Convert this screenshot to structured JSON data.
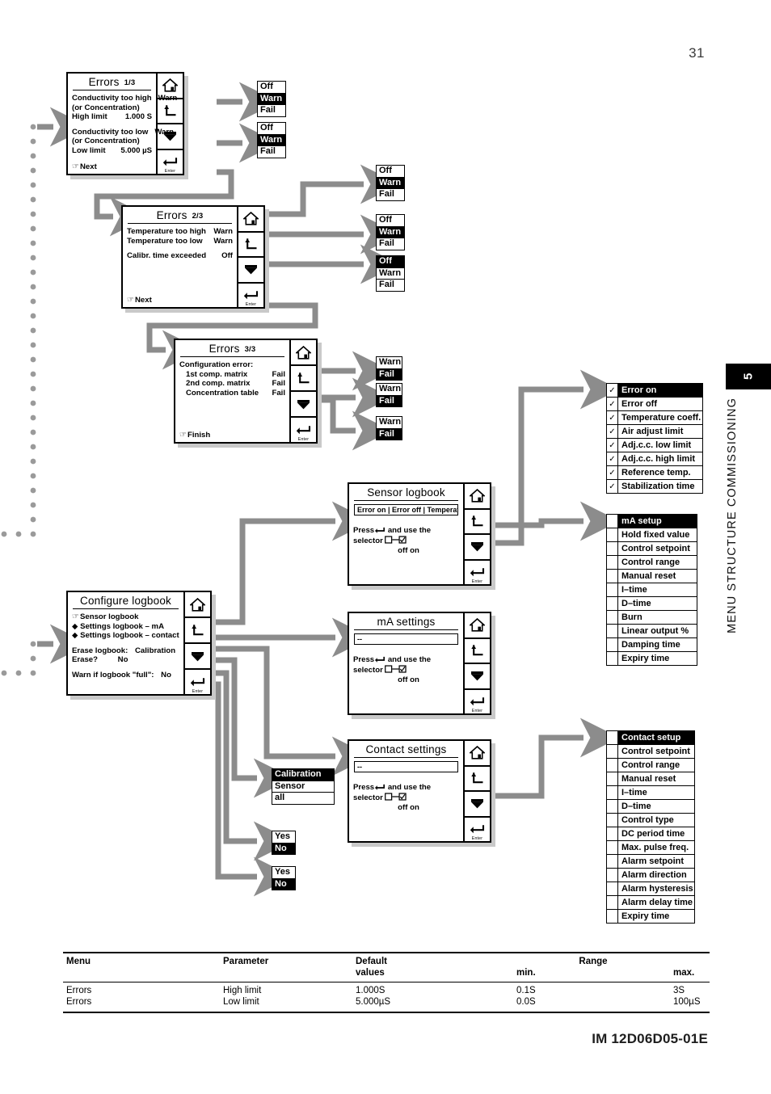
{
  "page": {
    "number": "31",
    "footer_code": "IM 12D06D05-01E",
    "side_tab_number": "5",
    "side_tab_title": "MENU STRUCTURE COMMISSIONING"
  },
  "panels": {
    "errors1": {
      "title": "Errors",
      "page_indicator": "1/3",
      "rows": [
        {
          "label": "Conductivity too high",
          "value": "Warn"
        },
        {
          "label": "(or Concentration)",
          "value": ""
        },
        {
          "label": "High limit",
          "value": "1.000 S"
        },
        {
          "label": "Conductivity too low",
          "value": "Warn"
        },
        {
          "label": "(or Concentration)",
          "value": ""
        },
        {
          "label": "Low limit",
          "value": "5.000  µS"
        }
      ],
      "footer": "Next"
    },
    "errors2": {
      "title": "Errors",
      "page_indicator": "2/3",
      "rows": [
        {
          "label": "Temperature too high",
          "value": "Warn"
        },
        {
          "label": "Temperature too low",
          "value": "Warn"
        },
        {
          "label": "Calibr. time exceeded",
          "value": "Off"
        }
      ],
      "footer": "Next"
    },
    "errors3": {
      "title": "Errors",
      "page_indicator": "3/3",
      "heading": "Configuration error:",
      "rows": [
        {
          "label": "1st comp. matrix",
          "value": "Fail"
        },
        {
          "label": "2nd comp. matrix",
          "value": "Fail"
        },
        {
          "label": "Concentration table",
          "value": "Fail"
        }
      ],
      "footer": "Finish"
    },
    "configure_logbook": {
      "title": "Configure logbook",
      "items": [
        "Sensor logbook",
        "Settings logbook – mA",
        "Settings logbook – contact"
      ],
      "rows": [
        {
          "label": "Erase logbook:",
          "value": "Calibration"
        },
        {
          "label": "Erase?",
          "value": "No"
        },
        {
          "label": "Warn if logbook \"full\":",
          "value": "No"
        }
      ]
    },
    "sensor_logbook": {
      "title": "Sensor logbook",
      "field_value": "Error on | Error off | Temperat",
      "press_line1": "Press",
      "press_enter_label": "Enter",
      "press_line1b": "and use the",
      "press_line2": "selector",
      "off_on": "off  on"
    },
    "ma_settings": {
      "title": "mA settings",
      "field_value": "--",
      "press_line1": "Press",
      "press_enter_label": "Enter",
      "press_line1b": "and use the",
      "press_line2": "selector",
      "off_on": "off  on"
    },
    "contact_settings": {
      "title": "Contact settings",
      "field_value": "--",
      "press_line1": "Press",
      "press_enter_label": "Enter",
      "press_line1b": "and use the",
      "press_line2": "selector",
      "off_on": "off  on"
    }
  },
  "nav_keys": [
    "home-icon",
    "back-icon",
    "down-icon",
    "enter-icon"
  ],
  "nav_enter_label": "Enter",
  "option_boxes": {
    "owf_a": {
      "options": [
        "Off",
        "Warn",
        "Fail"
      ],
      "selected": "Warn"
    },
    "owf_b": {
      "options": [
        "Off",
        "Warn",
        "Fail"
      ],
      "selected": "Warn"
    },
    "owf_c": {
      "options": [
        "Off",
        "Warn",
        "Fail"
      ],
      "selected": "Warn"
    },
    "owf_d": {
      "options": [
        "Off",
        "Warn",
        "Fail"
      ],
      "selected": "Warn"
    },
    "owf_e": {
      "options": [
        "Off",
        "Warn",
        "Fail"
      ],
      "selected": "Off"
    },
    "wf_a": {
      "options": [
        "Warn",
        "Fail"
      ],
      "selected": "Fail"
    },
    "wf_b": {
      "options": [
        "Warn",
        "Fail"
      ],
      "selected": "Fail"
    },
    "wf_c": {
      "options": [
        "Warn",
        "Fail"
      ],
      "selected": "Fail"
    },
    "erase_target": {
      "options": [
        "Calibration",
        "Sensor",
        "all"
      ],
      "selected": "Calibration"
    },
    "yesno_a": {
      "options": [
        "Yes",
        "No"
      ],
      "selected": "No"
    },
    "yesno_b": {
      "options": [
        "Yes",
        "No"
      ],
      "selected": "No"
    }
  },
  "checkbox_lists": {
    "sensor_logbook_items": {
      "header": "Error on",
      "header_checked": true,
      "items": [
        {
          "label": "Error off",
          "checked": true
        },
        {
          "label": "Temperature coeff.",
          "checked": true
        },
        {
          "label": "Air adjust limit",
          "checked": true
        },
        {
          "label": "Adj.c.c. low limit",
          "checked": true
        },
        {
          "label": "Adj.c.c. high limit",
          "checked": true
        },
        {
          "label": "Reference temp.",
          "checked": true
        },
        {
          "label": "Stabilization time",
          "checked": true
        }
      ]
    },
    "ma_setup_items": {
      "header": "mA setup",
      "header_checked": false,
      "items": [
        {
          "label": "Hold fixed value",
          "checked": false
        },
        {
          "label": "Control setpoint",
          "checked": false
        },
        {
          "label": "Control range",
          "checked": false
        },
        {
          "label": "Manual reset",
          "checked": false
        },
        {
          "label": "I–time",
          "checked": false
        },
        {
          "label": "D–time",
          "checked": false
        },
        {
          "label": "Burn",
          "checked": false
        },
        {
          "label": "Linear output %",
          "checked": false
        },
        {
          "label": "Damping time",
          "checked": false
        },
        {
          "label": "Expiry time",
          "checked": false
        }
      ]
    },
    "contact_setup_items": {
      "header": "Contact setup",
      "header_checked": false,
      "items": [
        {
          "label": "Control setpoint",
          "checked": false
        },
        {
          "label": "Control range",
          "checked": false
        },
        {
          "label": "Manual reset",
          "checked": false
        },
        {
          "label": "I–time",
          "checked": false
        },
        {
          "label": "D–time",
          "checked": false
        },
        {
          "label": "Control type",
          "checked": false
        },
        {
          "label": "DC period time",
          "checked": false
        },
        {
          "label": "Max. pulse freq.",
          "checked": false
        },
        {
          "label": "Alarm setpoint",
          "checked": false
        },
        {
          "label": "Alarm direction",
          "checked": false
        },
        {
          "label": "Alarm hysteresis",
          "checked": false
        },
        {
          "label": "Alarm delay time",
          "checked": false
        },
        {
          "label": "Expiry time",
          "checked": false
        }
      ]
    }
  },
  "spec_table": {
    "headers_row1": [
      "Menu",
      "Parameter",
      "Default",
      "Range",
      ""
    ],
    "headers_row2": [
      "",
      "",
      "values",
      "min.",
      "max."
    ],
    "rows": [
      {
        "menu": "Errors",
        "parameter": "High limit",
        "default": "1.000S",
        "min": "0.1S",
        "max": "3S"
      },
      {
        "menu": "Errors",
        "parameter": "Low limit",
        "default": "5.000µS",
        "min": "0.0S",
        "max": "100µS"
      }
    ]
  }
}
